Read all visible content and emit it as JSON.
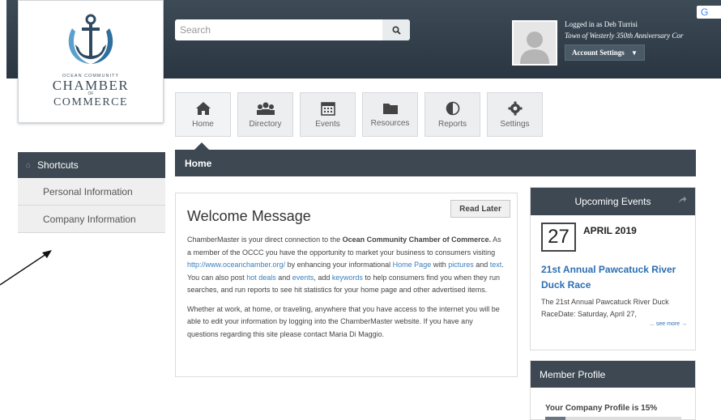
{
  "brand": {
    "line1": "OCEAN COMMUNITY",
    "line2": "CHAMBER",
    "line3": "OF",
    "line4": "COMMERCE"
  },
  "search": {
    "placeholder": "Search"
  },
  "user": {
    "logged_in": "Logged in as Deb Turrisi",
    "org": "Town of Westerly 350th Anniversary Cor",
    "account_settings": "Account Settings"
  },
  "google_badge": "G",
  "nav": [
    {
      "label": "Home",
      "icon": "home-icon"
    },
    {
      "label": "Directory",
      "icon": "directory-icon"
    },
    {
      "label": "Events",
      "icon": "calendar-icon"
    },
    {
      "label": "Resources",
      "icon": "folder-icon"
    },
    {
      "label": "Reports",
      "icon": "pie-chart-icon"
    },
    {
      "label": "Settings",
      "icon": "gear-icon"
    }
  ],
  "page_bar": "Home",
  "shortcuts": {
    "title": "Shortcuts",
    "items": [
      "Personal Information",
      "Company Information"
    ]
  },
  "welcome": {
    "title": "Welcome Message",
    "read_later": "Read Later",
    "p1": {
      "t1": "ChamberMaster is your direct connection to the ",
      "bold": "Ocean Community Chamber of Commerce.",
      "t2": " As a member of the OCCC you have the opportunity to market your business to consumers visiting ",
      "link_url": "http://www.oceanchamber.org/",
      "t3": " by enhancing your informational ",
      "link_home": "Home Page",
      "t4": " with ",
      "link_pictures": "pictures",
      "t5": " and ",
      "link_text": "text",
      "t6": ". You can also post ",
      "link_hot": "hot deals",
      "t7": " and ",
      "link_events": "events",
      "t8": ", add ",
      "link_keywords": "keywords",
      "t9": " to help consumers find you when they run searches, and run reports to see hit statistics for your home page and other advertised items."
    },
    "p2": "Whether at work, at home, or traveling, anywhere that you have access to the internet you will be able to edit your information by logging into the ChamberMaster website. If you have any questions regarding this site please contact Maria Di Maggio."
  },
  "events": {
    "title": "Upcoming Events",
    "day": "27",
    "month": "APRIL 2019",
    "event_title": "21st Annual Pawcatuck River Duck Race",
    "event_desc": "The 21st Annual Pawcatuck River Duck RaceDate:  Saturday, April 27,",
    "see_more": "... see more →"
  },
  "member": {
    "title": "Member Profile",
    "text": "Your Company Profile is 15%",
    "progress": 0.15
  },
  "colors": {
    "header_dark": "#2a3641",
    "bar_dark": "#3d4852",
    "link_blue": "#2c6fb3"
  }
}
